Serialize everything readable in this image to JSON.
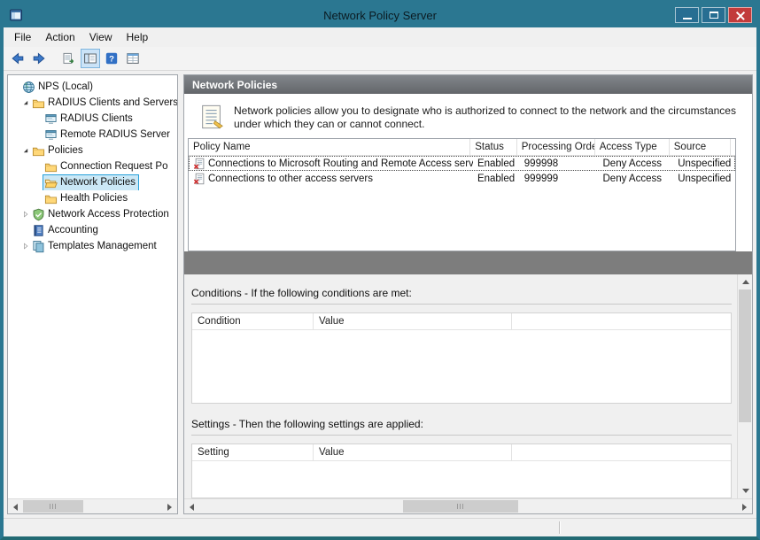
{
  "window": {
    "title": "Network Policy Server"
  },
  "menu": {
    "items": [
      "File",
      "Action",
      "View",
      "Help"
    ]
  },
  "toolbar": {
    "buttons": [
      "back",
      "forward",
      "export-list",
      "show-hide-console-tree",
      "help",
      "icon-view"
    ]
  },
  "tree": {
    "items": [
      {
        "label": "NPS (Local)",
        "icon": "globe-icon",
        "selected": false
      },
      {
        "label": "RADIUS Clients and Servers",
        "icon": "folder-icon",
        "selected": false
      },
      {
        "label": "RADIUS Clients",
        "icon": "radius-client-icon",
        "selected": false
      },
      {
        "label": "Remote RADIUS Server",
        "icon": "radius-server-icon",
        "selected": false
      },
      {
        "label": "Policies",
        "icon": "folder-icon",
        "selected": false
      },
      {
        "label": "Connection Request Po",
        "icon": "folder-icon",
        "selected": false
      },
      {
        "label": "Network Policies",
        "icon": "open-folder-icon",
        "selected": true
      },
      {
        "label": "Health Policies",
        "icon": "folder-icon",
        "selected": false
      },
      {
        "label": "Network Access Protection",
        "icon": "nap-icon",
        "selected": false
      },
      {
        "label": "Accounting",
        "icon": "accounting-icon",
        "selected": false
      },
      {
        "label": "Templates Management",
        "icon": "templates-icon",
        "selected": false
      }
    ]
  },
  "main": {
    "header": "Network Policies",
    "description": "Network policies allow you to designate who is authorized to connect to the network and the circumstances under which they can or cannot connect.",
    "policies": {
      "columns": [
        "Policy Name",
        "Status",
        "Processing Order",
        "Access Type",
        "Source"
      ],
      "rows": [
        {
          "policy_name": "Connections to Microsoft Routing and Remote Access server",
          "status": "Enabled",
          "processing_order": "999998",
          "access_type": "Deny Access",
          "source": "Unspecified"
        },
        {
          "policy_name": "Connections to other access servers",
          "status": "Enabled",
          "processing_order": "999999",
          "access_type": "Deny Access",
          "source": "Unspecified"
        }
      ]
    },
    "conditions": {
      "title": "Conditions - If the following conditions are met:",
      "columns": [
        "Condition",
        "Value"
      ]
    },
    "settings": {
      "title": "Settings - Then the following settings are applied:",
      "columns": [
        "Setting",
        "Value"
      ]
    }
  },
  "colors": {
    "titlebar": "#2b7791",
    "close_button": "#c23b3b",
    "tree_selection_fill": "#cbe8f6",
    "tree_selection_border": "#26a0da",
    "content_header_band": "#6f7276",
    "separator_band": "#7d7d7d"
  }
}
